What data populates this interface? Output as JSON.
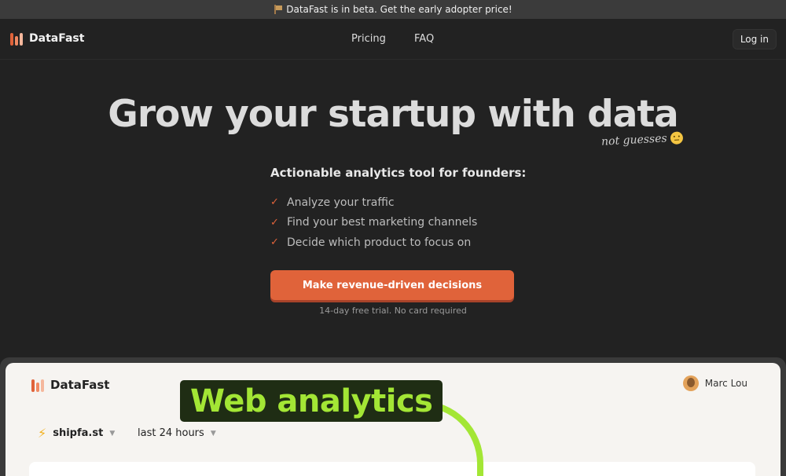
{
  "banner": {
    "text": "DataFast is in beta. Get the early adopter price!",
    "icon": "flag-icon"
  },
  "nav": {
    "brand": "DataFast",
    "links": [
      "Pricing",
      "FAQ"
    ],
    "login": "Log in"
  },
  "hero": {
    "title": "Grow your startup with data",
    "annotation": "not guesses",
    "subhead": "Actionable analytics tool for founders:",
    "features": [
      "Analyze your traffic",
      "Find your best marketing channels",
      "Decide which product to focus on"
    ],
    "cta": "Make revenue-driven decisions",
    "trial": "14-day free trial. No card required"
  },
  "preview": {
    "brand": "DataFast",
    "user": "Marc Lou",
    "site": "shipfa.st",
    "range": "last 24 hours",
    "overlay_label": "Web analytics"
  },
  "colors": {
    "background": "#222222",
    "accent": "#e0633a",
    "highlight": "#a3e635",
    "logo_bars": [
      "#e0633a",
      "#f08a63",
      "#f5b79c"
    ]
  }
}
